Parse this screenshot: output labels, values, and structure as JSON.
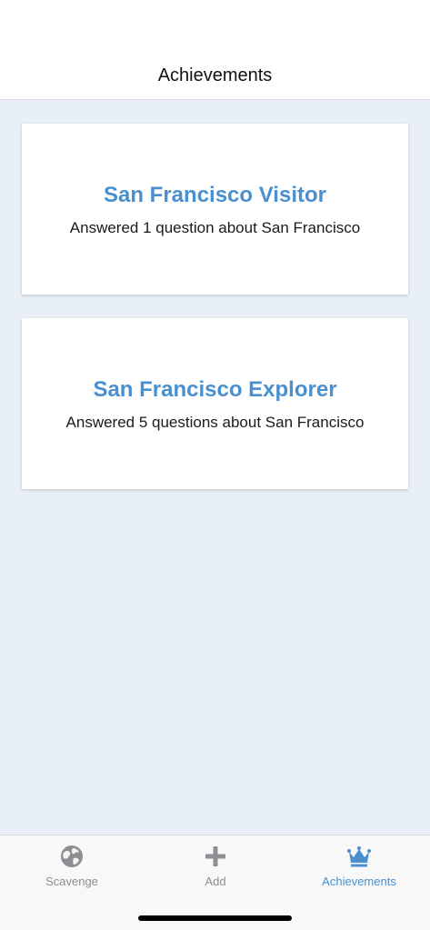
{
  "header": {
    "title": "Achievements"
  },
  "achievements": [
    {
      "title": "San Francisco Visitor",
      "description": "Answered 1 question about San Francisco"
    },
    {
      "title": "San Francisco Explorer",
      "description": "Answered 5 questions about San Francisco"
    }
  ],
  "tabbar": {
    "tabs": [
      {
        "label": "Scavenge",
        "icon": "globe-icon",
        "active": false
      },
      {
        "label": "Add",
        "icon": "plus-icon",
        "active": false
      },
      {
        "label": "Achievements",
        "icon": "crown-icon",
        "active": true
      }
    ]
  },
  "colors": {
    "accent": "#4a90cf",
    "background": "#e8eff6",
    "inactive_tab": "#8e8e93"
  }
}
